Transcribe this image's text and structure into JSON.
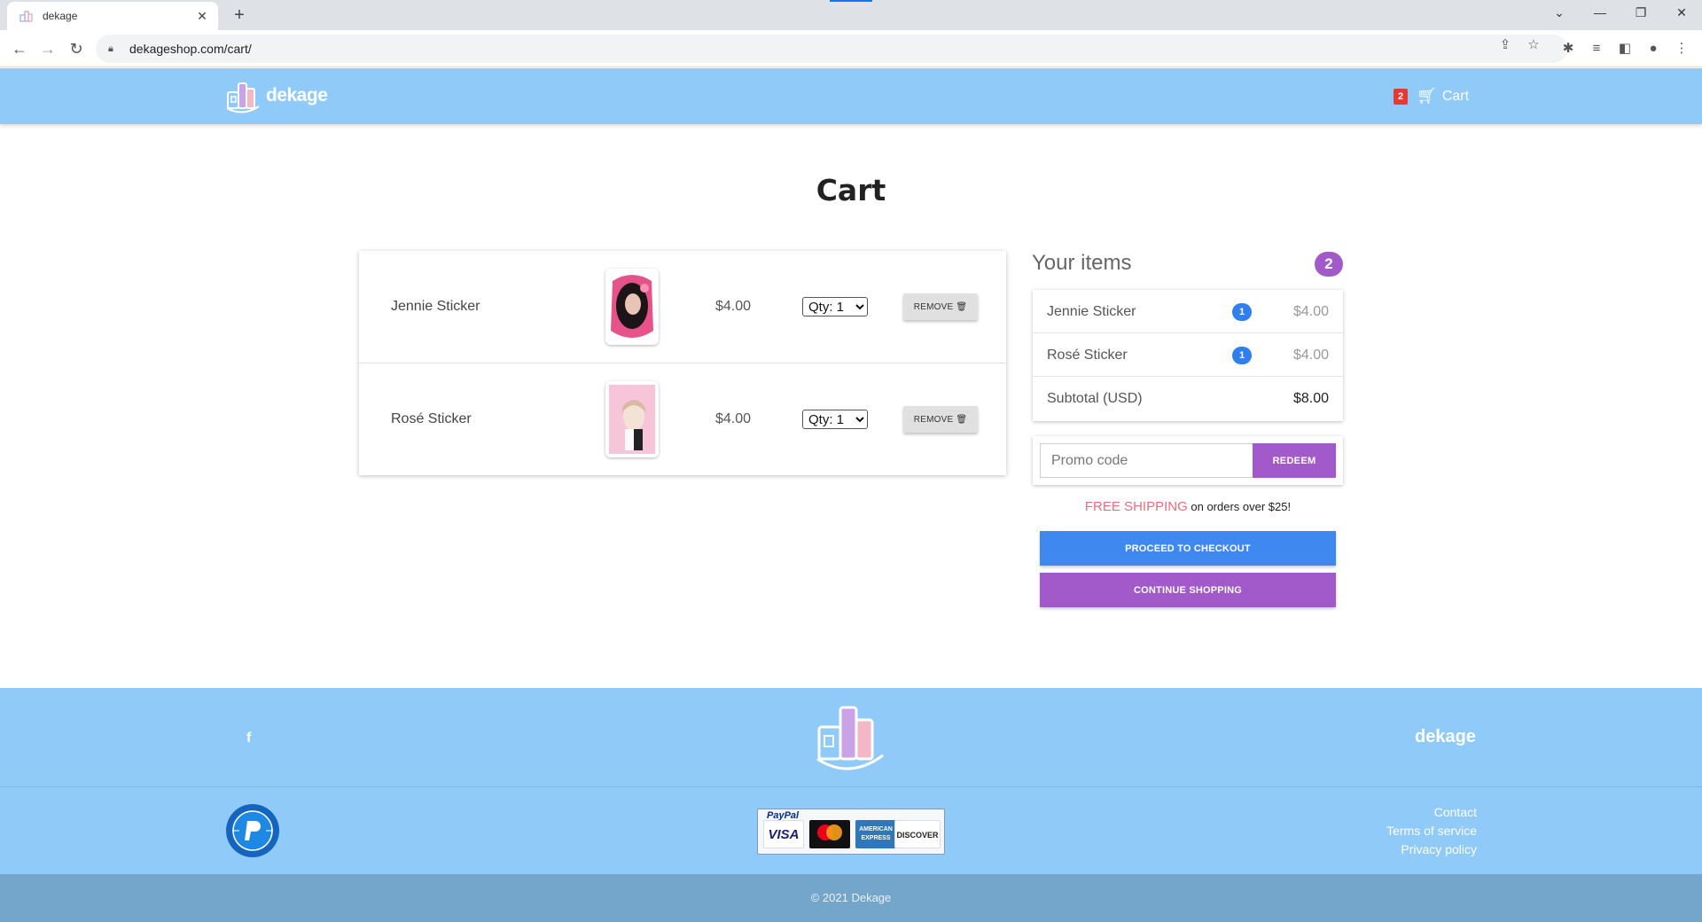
{
  "browser": {
    "tab_title": "dekage",
    "url": "dekageshop.com/cart/"
  },
  "header": {
    "brand": "dekage",
    "cart_count": "2",
    "cart_label": "Cart",
    "bg_color": "#90caf9"
  },
  "page": {
    "title": "Cart"
  },
  "cart_items": [
    {
      "name": "Jennie Sticker",
      "price": "$4.00",
      "qty": "Qty: 1",
      "remove_label": "REMOVE"
    },
    {
      "name": "Rosé Sticker",
      "price": "$4.00",
      "qty": "Qty: 1",
      "remove_label": "REMOVE"
    }
  ],
  "summary": {
    "heading": "Your items",
    "count": "2",
    "items": [
      {
        "name": "Jennie Sticker",
        "qty": "1",
        "price": "$4.00"
      },
      {
        "name": "Rosé Sticker",
        "qty": "1",
        "price": "$4.00"
      }
    ],
    "subtotal_label": "Subtotal (USD)",
    "subtotal_value": "$8.00"
  },
  "promo": {
    "placeholder": "Promo code",
    "button_label": "REDEEM"
  },
  "shipping": {
    "highlight": "FREE SHIPPING",
    "rest": "on orders over $25!"
  },
  "actions": {
    "checkout_label": "PROCEED TO CHECKOUT",
    "continue_label": "CONTINUE SHOPPING",
    "checkout_color": "#3f88ef",
    "continue_color": "#a25acb"
  },
  "footer": {
    "facebook_icon": "f",
    "brand": "dekage",
    "paypal_label": "PayPal",
    "cards": [
      "VISA",
      "mastercard",
      "AMERICAN EXPRESS",
      "DISCOVER"
    ],
    "links": [
      "Contact",
      "Terms of service",
      "Privacy policy"
    ],
    "copyright": "© 2021 Dekage"
  }
}
